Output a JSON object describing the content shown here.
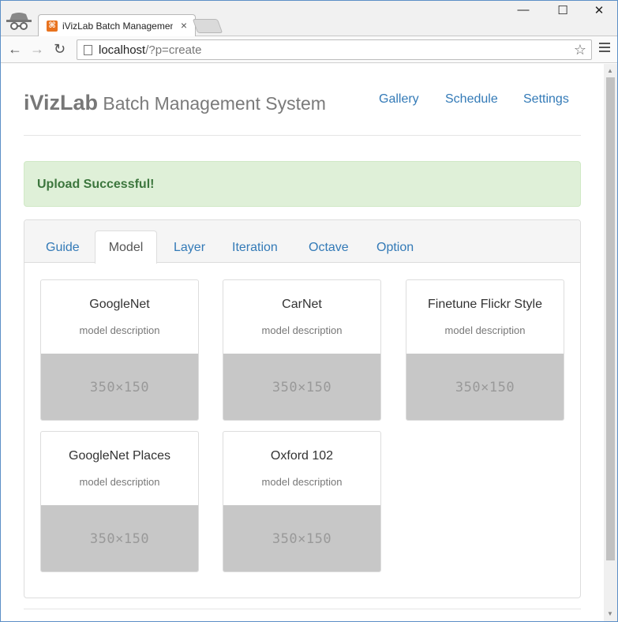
{
  "browser": {
    "tab_title": "iVizLab Batch Managemen",
    "tab_close": "×",
    "url_host": "localhost",
    "url_path": "/?p=create",
    "minimize": "—",
    "maximize": "☐",
    "close": "✕",
    "back": "←",
    "forward": "→",
    "reload": "↻",
    "star": "☆",
    "favicon_color": "#e8731f"
  },
  "header": {
    "brand_strong": "iVizLab",
    "brand_light": " Batch Management System",
    "nav": {
      "gallery": "Gallery",
      "schedule": "Schedule",
      "settings": "Settings"
    }
  },
  "alert": {
    "text": "Upload Successful!",
    "color": "#dff0d8"
  },
  "tabs": {
    "guide": "Guide",
    "model": "Model",
    "layer": "Layer",
    "iteration": "Iteration",
    "octave": "Octave",
    "option": "Option",
    "active": "Model"
  },
  "models": [
    {
      "title": "GoogleNet",
      "desc": "model description",
      "img": "350×150"
    },
    {
      "title": "CarNet",
      "desc": "model description",
      "img": "350×150"
    },
    {
      "title": "Finetune Flickr Style",
      "desc": "model description",
      "img": "350×150"
    },
    {
      "title": "GoogleNet Places",
      "desc": "model description",
      "img": "350×150"
    },
    {
      "title": "Oxford 102",
      "desc": "model description",
      "img": "350×150"
    }
  ],
  "colors": {
    "link": "#337ab7",
    "success_text": "#3c763d"
  }
}
